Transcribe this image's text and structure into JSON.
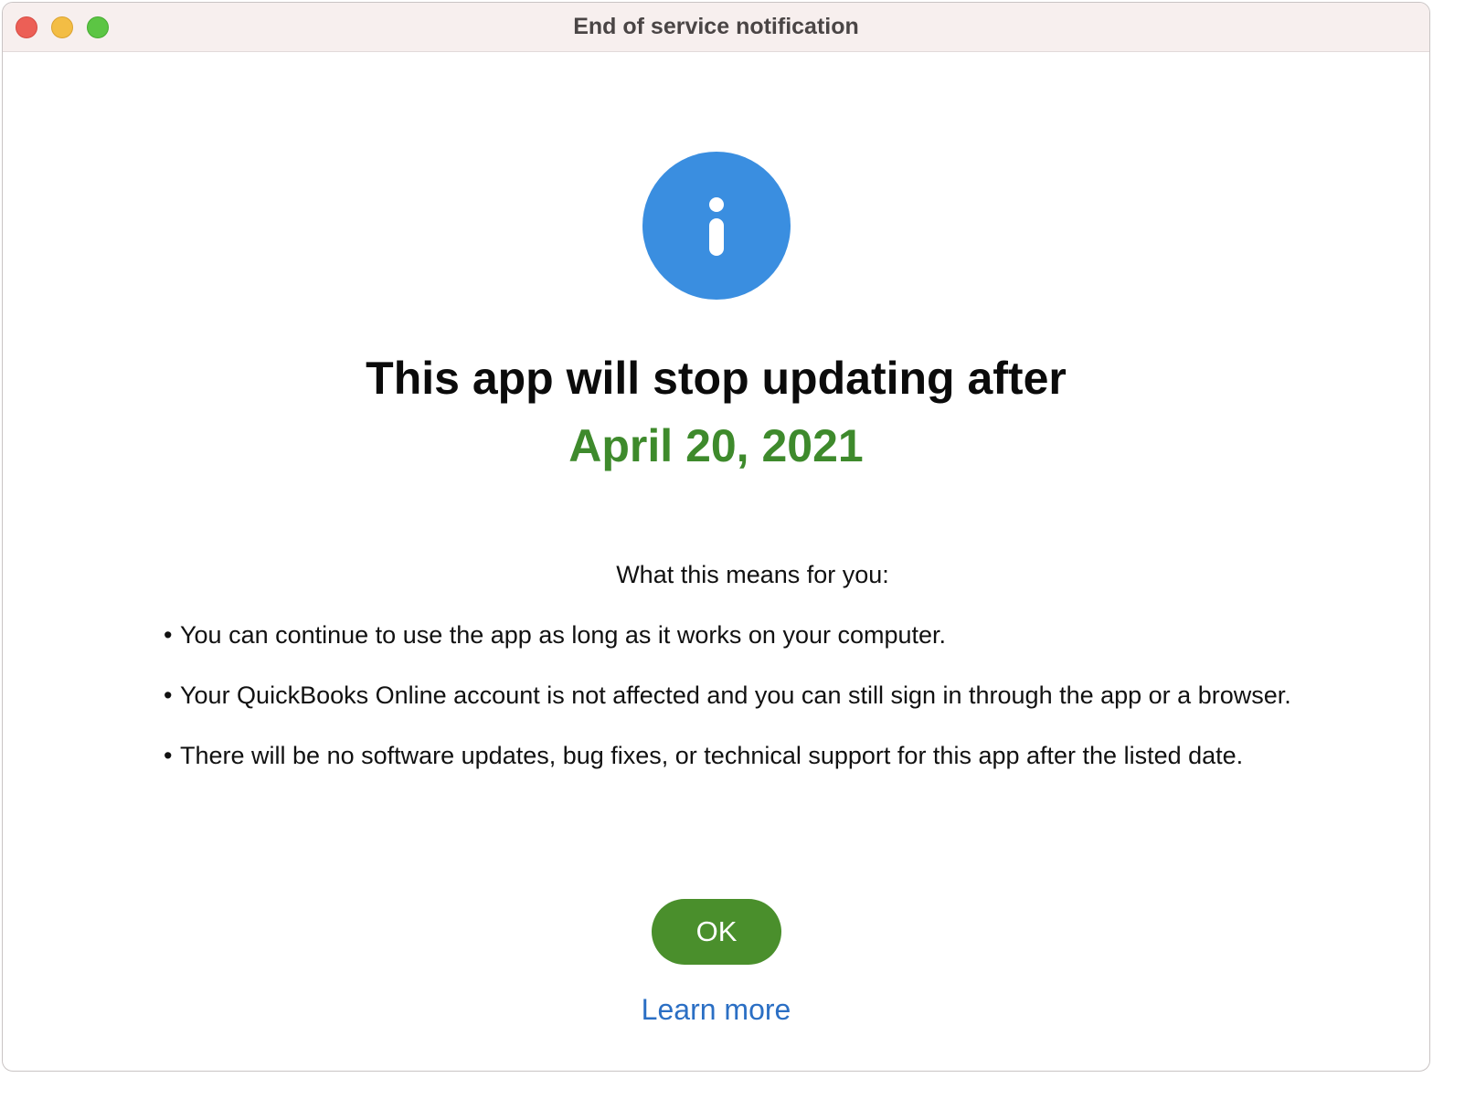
{
  "window": {
    "title": "End of service notification"
  },
  "icon": {
    "name": "info-icon",
    "color": "#3a8ee0"
  },
  "headline": "This app will stop updating after",
  "date": {
    "text": "April 20, 2021",
    "color": "#3e8a2c"
  },
  "means_heading": "What this means for you:",
  "bullets": [
    "You can continue to use the app as long as it works on your computer.",
    "Your QuickBooks Online account is not affected and you can still sign in through the app or a browser.",
    "There will be no software updates, bug fixes, or technical support for this app after the listed date."
  ],
  "bullet_glyph": "•",
  "ok_button": {
    "label": "OK",
    "color": "#4a8f2c"
  },
  "learn_more": {
    "label": "Learn more",
    "color": "#2b6fc4"
  }
}
